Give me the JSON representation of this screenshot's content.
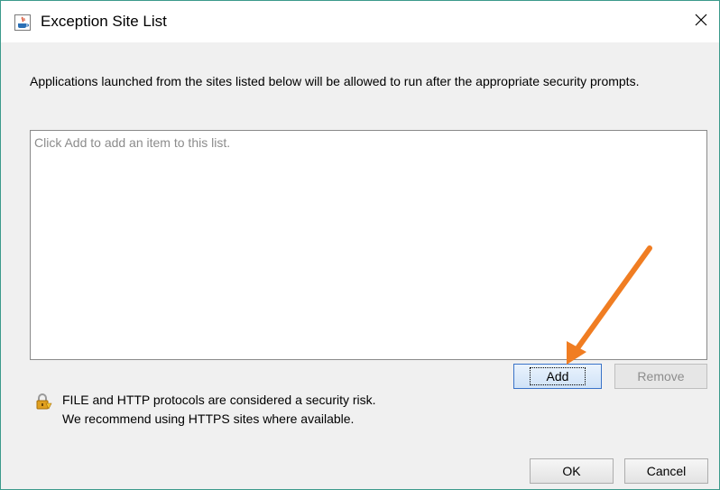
{
  "window": {
    "title": "Exception Site List",
    "close_glyph": "✕",
    "icon": "java-icon"
  },
  "description": "Applications launched from the sites listed below will be allowed to run after the appropriate security prompts.",
  "site_list": {
    "placeholder": "Click Add to add an item to this list.",
    "items": []
  },
  "buttons": {
    "add": "Add",
    "remove": "Remove",
    "ok": "OK",
    "cancel": "Cancel"
  },
  "warning": {
    "icon": "lock-warning-icon",
    "line1": "FILE and HTTP protocols are considered a security risk.",
    "line2": "We recommend using HTTPS sites where available."
  },
  "annotation": {
    "arrow_color": "#f07d22"
  }
}
